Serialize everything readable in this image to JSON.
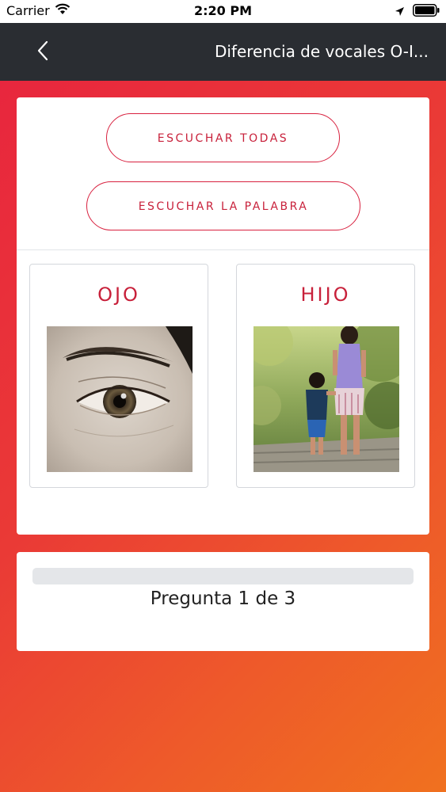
{
  "status_bar": {
    "carrier": "Carrier",
    "time": "2:20 PM",
    "icons": [
      "wifi-icon",
      "location-arrow-icon",
      "battery-icon"
    ]
  },
  "nav": {
    "back_icon": "chevron-left-icon",
    "title": "Diferencia de vocales O-I..."
  },
  "buttons": {
    "listen_all": "ESCUCHAR TODAS",
    "listen_word": "ESCUCHAR LA PALABRA"
  },
  "options": [
    {
      "word": "OJO",
      "image": "eye-photo"
    },
    {
      "word": "HIJO",
      "image": "mother-and-child-walking-photo"
    }
  ],
  "progress": {
    "label": "Pregunta 1 de 3",
    "fraction": 0
  },
  "colors": {
    "accent": "#c8213b",
    "nav_background": "#2a2d32",
    "gradient_start": "#e8233f",
    "gradient_end": "#f0711f"
  }
}
